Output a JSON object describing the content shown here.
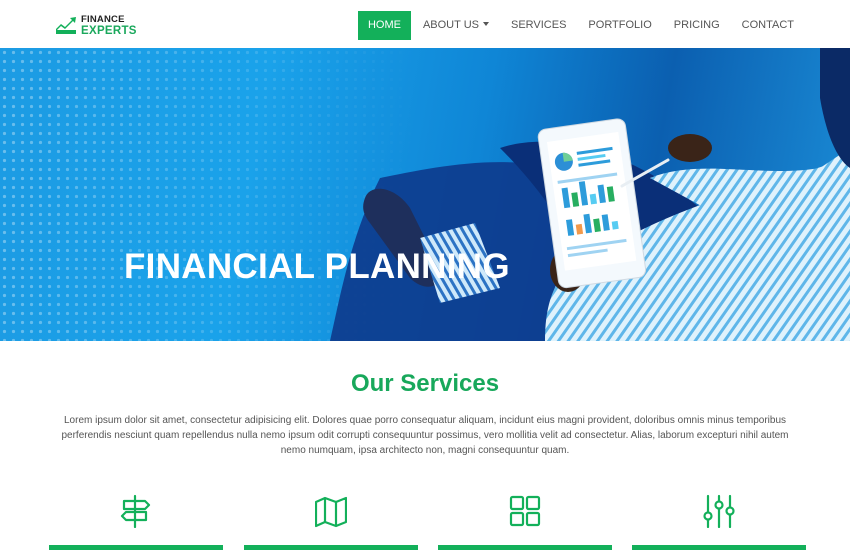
{
  "brand": {
    "line1": "FINANCE",
    "line2": "EXPERTS",
    "icon": "rising-chart-logo-icon"
  },
  "nav": {
    "items": [
      {
        "label": "HOME",
        "active": true
      },
      {
        "label": "ABOUT US",
        "dropdown": true
      },
      {
        "label": "SERVICES"
      },
      {
        "label": "PORTFOLIO"
      },
      {
        "label": "PRICING"
      },
      {
        "label": "CONTACT"
      }
    ]
  },
  "hero": {
    "title": "FINANCIAL PLANNING"
  },
  "services": {
    "title": "Our Services",
    "description": "Lorem ipsum dolor sit amet, consectetur adipisicing elit. Dolores quae porro consequatur aliquam, incidunt eius magni provident, doloribus omnis minus temporibus perferendis nesciunt quam repellendus nulla nemo ipsum odit corrupti consequuntur possimus, vero mollitia velit ad consectetur. Alias, laborum excepturi nihil autem nemo numquam, ipsa architecto non, magni consequuntur quam.",
    "cards": [
      {
        "icon": "signpost-icon"
      },
      {
        "icon": "map-icon"
      },
      {
        "icon": "grid-icon"
      },
      {
        "icon": "sliders-icon"
      }
    ]
  },
  "colors": {
    "accent": "#13b05a",
    "hero_blue": "#1a9be3",
    "text": "#555555"
  }
}
